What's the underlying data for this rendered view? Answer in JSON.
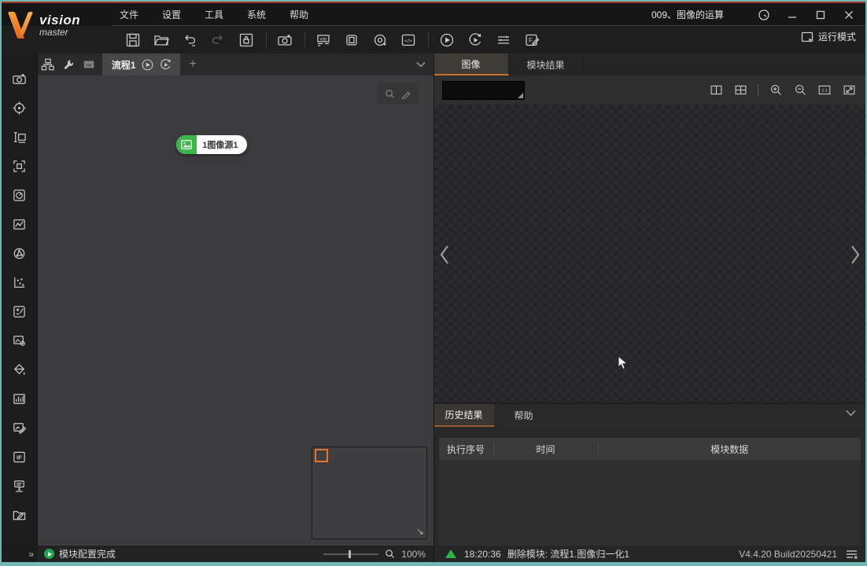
{
  "colors": {
    "accent_orange": "#c8702e",
    "node_green": "#3cb54a",
    "status_green": "#2cb34a",
    "frame_teal": "#71b7b3",
    "frame_red": "#a23726",
    "canvas_bg": "#3b3b3d"
  },
  "logo": {
    "line1": "vision",
    "line2": "master"
  },
  "titlebar": {
    "title": "009、图像的运算",
    "menu": [
      {
        "label": "文件"
      },
      {
        "label": "设置"
      },
      {
        "label": "工具"
      },
      {
        "label": "系统"
      },
      {
        "label": "帮助"
      }
    ],
    "controls": [
      "timer-icon",
      "minimize-icon",
      "maximize-icon",
      "close-icon"
    ]
  },
  "toolbar": {
    "icons": [
      "save",
      "open",
      "undo",
      "redo",
      "save-lock",
      "camera",
      "variables",
      "module",
      "communication",
      "code",
      "run-once",
      "run-continuous",
      "global-trigger",
      "report-edit"
    ],
    "run_mode_label": "运行模式"
  },
  "sidebar": {
    "icons": [
      "acquisition-camera",
      "location-target",
      "measure",
      "recognition",
      "calibration",
      "alignment-contour",
      "3d-sphere",
      "point-grid",
      "calculator",
      "image-process-gear",
      "color-fill",
      "defect-histogram",
      "image-edit",
      "if-logic",
      "communication-net",
      "script-folder"
    ],
    "collapse_glyph": "»"
  },
  "flowbar": {
    "icons": [
      "flowchart",
      "wrench",
      "variables"
    ],
    "tab_label": "流程1",
    "tab_icons": [
      "run-once",
      "run-continuous"
    ],
    "add_label": "+",
    "collapse_glyph": "⌄"
  },
  "canvas": {
    "node": {
      "label": "1图像源1",
      "icon": "image-source"
    },
    "minimap": {
      "viewport_color": "#e8732a",
      "resize_glyph": "↘"
    }
  },
  "right_panel": {
    "tabs": [
      {
        "label": "图像",
        "active": true
      },
      {
        "label": "模块结果",
        "active": false
      }
    ],
    "viewer_icons": [
      "split-view",
      "grid-view",
      "zoom-in",
      "zoom-out",
      "one-to-one",
      "fit-window"
    ],
    "nav": {
      "prev_glyph": "‹",
      "next_glyph": "›"
    },
    "history": {
      "tabs": [
        {
          "label": "历史结果",
          "active": true
        },
        {
          "label": "帮助",
          "active": false
        }
      ],
      "collapse_glyph": "⌄",
      "columns": [
        {
          "label": "执行序号"
        },
        {
          "label": "时间"
        },
        {
          "label": "模块数据"
        }
      ],
      "rows": []
    }
  },
  "statusbar": {
    "left_message": "模块配置完成",
    "zoom_level": "100%",
    "event_time": "18:20:36",
    "event_message": "删除模块: 流程1.图像归一化1",
    "version": "V4.4.20 Build20250421"
  }
}
